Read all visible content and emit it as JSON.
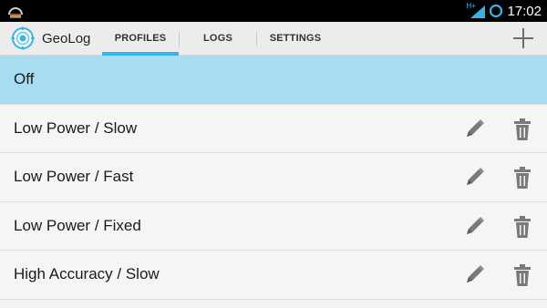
{
  "status_bar": {
    "time": "17:02",
    "network_type": "H+",
    "icons": [
      "app-notification-icon",
      "signal-icon",
      "sync-icon"
    ]
  },
  "action_bar": {
    "app_title": "GeoLog",
    "tabs": [
      {
        "label": "PROFILES",
        "active": true
      },
      {
        "label": "LOGS",
        "active": false
      },
      {
        "label": "SETTINGS",
        "active": false
      }
    ],
    "add_icon": "plus-icon"
  },
  "profiles": {
    "selected": {
      "label": "Off"
    },
    "items": [
      {
        "label": "Low Power / Slow"
      },
      {
        "label": "Low Power / Fast"
      },
      {
        "label": "Low Power / Fixed"
      },
      {
        "label": "High Accuracy / Slow"
      }
    ],
    "edit_icon": "pencil-icon",
    "delete_icon": "trash-icon"
  },
  "colors": {
    "accent": "#33b5e5",
    "selected_row": "#a7dcf2",
    "status_bar": "#000000",
    "icon_gray": "#7a7a7a"
  }
}
